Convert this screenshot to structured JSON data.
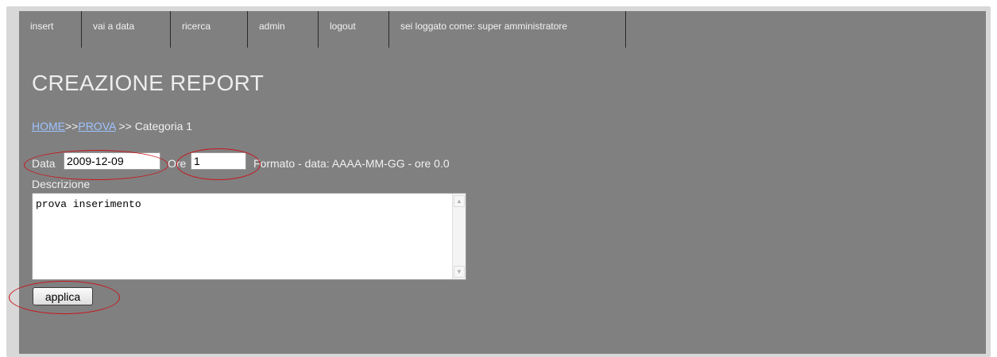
{
  "nav": {
    "items": [
      {
        "label": "insert"
      },
      {
        "label": "vai a data"
      },
      {
        "label": "ricerca"
      },
      {
        "label": "admin"
      },
      {
        "label": "logout"
      }
    ],
    "user_status": "sei loggato come: super amministratore"
  },
  "page": {
    "title": "CREAZIONE REPORT"
  },
  "breadcrumb": {
    "home": "HOME",
    "sep1": ">>",
    "prova": "PROVA",
    "rest": " >> Categoria 1"
  },
  "form": {
    "data_label": "Data",
    "data_value": "2009-12-09",
    "ore_label": "Ore",
    "ore_value": "1",
    "format_hint": "Formato - data: AAAA-MM-GG - ore 0.0",
    "descrizione_label": "Descrizione",
    "descrizione_value": "prova inserimento",
    "submit_label": "applica"
  },
  "colors": {
    "panel_bg": "#808080",
    "link": "#9ec3ff",
    "annotation": "#c8151b"
  }
}
